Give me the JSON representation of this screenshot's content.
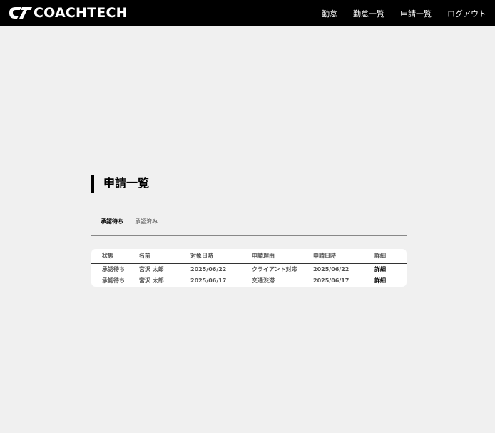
{
  "header": {
    "logo_text": "COACHTECH",
    "nav": [
      "勤怠",
      "勤怠一覧",
      "申請一覧",
      "ログアウト"
    ]
  },
  "page": {
    "title": "申請一覧",
    "tabs": [
      {
        "label": "承認待ち",
        "active": true
      },
      {
        "label": "承認済み",
        "active": false
      }
    ]
  },
  "table": {
    "headers": [
      "状態",
      "名前",
      "対象日時",
      "申請理由",
      "申請日時",
      "詳細"
    ],
    "rows": [
      {
        "status": "承認待ち",
        "name": "宮沢 太郎",
        "target_date": "2025/06/22",
        "reason": "クライアント対応",
        "applied_date": "2025/06/22",
        "detail": "詳細"
      },
      {
        "status": "承認待ち",
        "name": "宮沢 太郎",
        "target_date": "2025/06/17",
        "reason": "交通渋滞",
        "applied_date": "2025/06/17",
        "detail": "詳細"
      }
    ]
  },
  "colors": {
    "header_bg": "#000000",
    "page_bg": "#f0f0f0",
    "card_bg": "#ffffff"
  }
}
